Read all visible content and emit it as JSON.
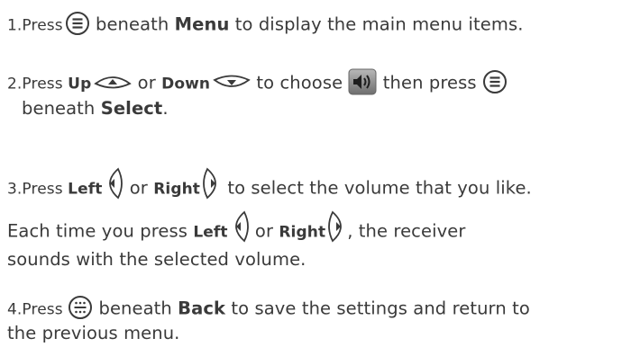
{
  "steps": [
    {
      "num": "1.Press",
      "after_icon": " beneath ",
      "key": "Menu",
      "rest": " to display the main menu items."
    },
    {
      "num": "2.Press ",
      "up": "Up",
      "or": " or ",
      "down": "Down",
      "choose": " to choose ",
      "then": " then press ",
      "line2_pre": "beneath ",
      "key": "Select",
      "line2_post": "."
    },
    {
      "num": "3.Press ",
      "left": "Left",
      "or": " or ",
      "right": "Right",
      "rest": " to select the volume that you like."
    },
    {
      "pre": "Each time you press ",
      "left": "Left",
      "or": " or ",
      "right": "Right",
      "post": ", the receiver",
      "line2": "sounds with the selected volume."
    },
    {
      "num": "4.Press ",
      "after_icon": " beneath ",
      "key": "Back",
      "rest": " to save the settings and return to",
      "line2": "the previous menu."
    }
  ],
  "icons": {
    "menu_key": "menu-softkey-icon",
    "up_key": "up-arrow-key-icon",
    "down_key": "down-arrow-key-icon",
    "volume": "speaker-volume-icon",
    "left_key": "left-arrow-key-icon",
    "right_key": "right-arrow-key-icon",
    "back_key": "back-softkey-icon"
  },
  "colors": {
    "text": "#3a3a3a",
    "volume_tile": "#8a8a8a"
  }
}
